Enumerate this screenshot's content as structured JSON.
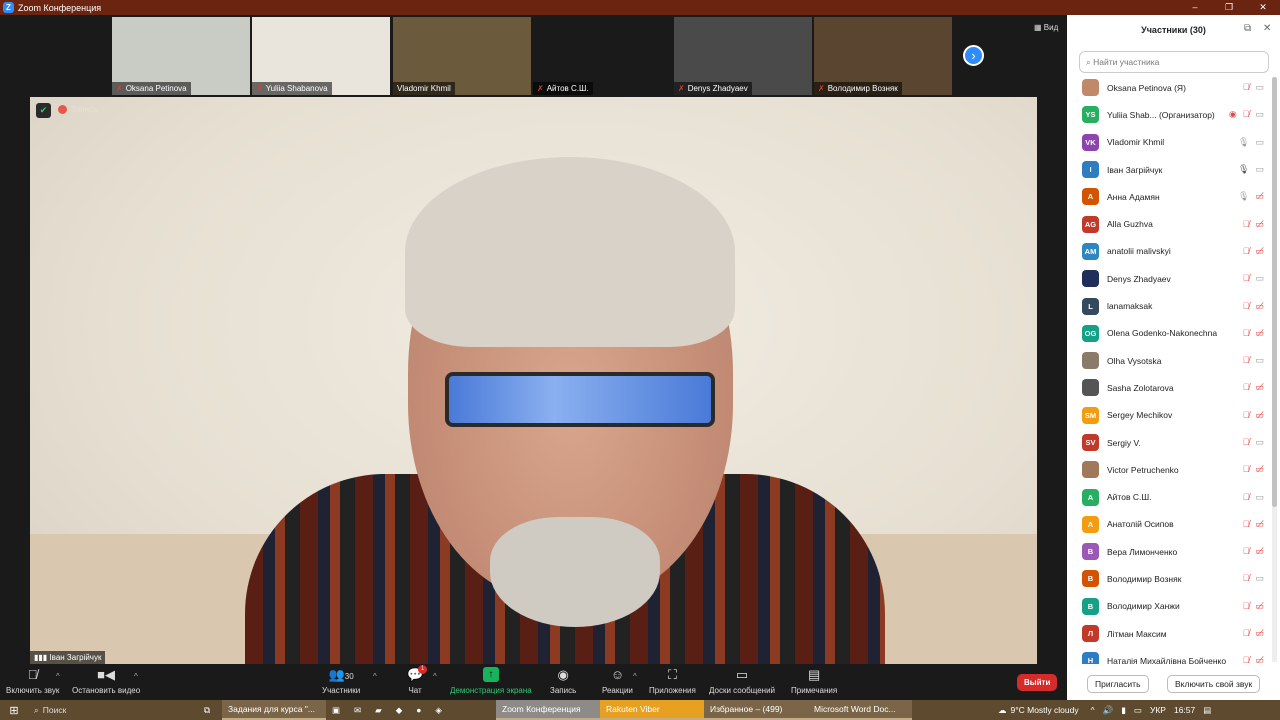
{
  "window": {
    "title": "Zoom Конференция",
    "controls": [
      "–",
      "❐",
      "✕"
    ]
  },
  "gallery": {
    "thumbnails": [
      {
        "name": "Oksana Petinova",
        "muted": true,
        "bg": "#c9ccc5"
      },
      {
        "name": "Yuliia Shabanova",
        "muted": true,
        "bg": "#e9e4dc"
      },
      {
        "name": "Vladomir Khmil",
        "muted": false,
        "bg": "#6b5a3c"
      },
      {
        "name": "Айтов  С.Ш.",
        "muted": true,
        "bg": "#1b1a1a"
      },
      {
        "name": "Denys Zhadyaev",
        "muted": true,
        "bg": "#4a4a4a"
      },
      {
        "name": "Володимир Возняк",
        "muted": true,
        "bg": "#5a4630"
      }
    ],
    "next_icon": "chevron-right-icon",
    "view_label": "Вид"
  },
  "main_video": {
    "speaker": "Іван Загрійчук",
    "recording_label": "Запись"
  },
  "toolbar": {
    "unmute": "Включить звук",
    "stop_video": "Остановить видео",
    "participants": "Участники",
    "participants_count": "30",
    "chat": "Чат",
    "chat_badge": "1",
    "share": "Демонстрация экрана",
    "record": "Запись",
    "reactions": "Реакции",
    "apps": "Приложения",
    "whiteboards": "Доски сообщений",
    "notes": "Примечания",
    "leave": "Выйти"
  },
  "panel": {
    "title": "Участники (30)",
    "search_placeholder": "Найти участника",
    "invite": "Пригласить",
    "unmute_self": "Включить свой звук",
    "participants": [
      {
        "name": "Oksana Petinova (Я)",
        "initials": "",
        "color": "#c08a6a",
        "mic": "muted",
        "video": "on"
      },
      {
        "name": "Yuliia Shab...  (Организатор)",
        "initials": "YS",
        "color": "#27ae60",
        "mic": "muted",
        "video": "on",
        "recording": true
      },
      {
        "name": "Vladomir Khmil",
        "initials": "VK",
        "color": "#8e44ad",
        "mic": "on",
        "video": "on"
      },
      {
        "name": "Іван Загрійчук",
        "initials": "I",
        "color": "#2e7dc1",
        "mic": "speaking",
        "video": "on"
      },
      {
        "name": "Анна Адамян",
        "initials": "A",
        "color": "#d35400",
        "mic": "on",
        "video": "off"
      },
      {
        "name": "Alla Guzhva",
        "initials": "AG",
        "color": "#c0392b",
        "mic": "muted",
        "video": "off"
      },
      {
        "name": "anatolii malivskyi",
        "initials": "AM",
        "color": "#2e86c1",
        "mic": "muted",
        "video": "off"
      },
      {
        "name": "Denys Zhadyaev",
        "initials": "",
        "color": "#1f2f5a",
        "mic": "muted",
        "video": "on"
      },
      {
        "name": "lanamaksak",
        "initials": "L",
        "color": "#34495e",
        "mic": "muted",
        "video": "off"
      },
      {
        "name": "Olena Godenko-Nakonechna",
        "initials": "OG",
        "color": "#16a085",
        "mic": "muted",
        "video": "off"
      },
      {
        "name": "Olha Vysotska",
        "initials": "",
        "color": "#8a7a6a",
        "mic": "muted",
        "video": "on"
      },
      {
        "name": "Sasha Zolotarova",
        "initials": "",
        "color": "#555",
        "mic": "muted",
        "video": "off"
      },
      {
        "name": "Sergey Mechikov",
        "initials": "SM",
        "color": "#f39c12",
        "mic": "muted",
        "video": "off"
      },
      {
        "name": "Sergiy V.",
        "initials": "SV",
        "color": "#c0392b",
        "mic": "muted",
        "video": "on"
      },
      {
        "name": "Victor Petruchenko",
        "initials": "",
        "color": "#a0785a",
        "mic": "muted",
        "video": "off"
      },
      {
        "name": "Айтов  С.Ш.",
        "initials": "A",
        "color": "#27ae60",
        "mic": "muted",
        "video": "on"
      },
      {
        "name": "Анатолій Осипов",
        "initials": "A",
        "color": "#f39c12",
        "mic": "muted",
        "video": "off"
      },
      {
        "name": "Вера Лимонченко",
        "initials": "B",
        "color": "#9b59b6",
        "mic": "muted",
        "video": "off"
      },
      {
        "name": "Володимир Возняк",
        "initials": "B",
        "color": "#d35400",
        "mic": "muted",
        "video": "on"
      },
      {
        "name": "Володимир Ханжи",
        "initials": "B",
        "color": "#16a085",
        "mic": "muted",
        "video": "off"
      },
      {
        "name": "Літман Максим",
        "initials": "Л",
        "color": "#c0392b",
        "mic": "muted",
        "video": "off"
      },
      {
        "name": "Наталія Михайлівна Бойченко",
        "initials": "Н",
        "color": "#2e7dc1",
        "mic": "muted",
        "video": "off"
      }
    ]
  },
  "taskbar": {
    "search": "Поиск",
    "apps": [
      "Задания для курса \"...",
      "Zoom Конференция",
      "Rakuten Viber",
      "Избранное – (499)",
      "Microsoft Word Doc..."
    ],
    "weather": "9°C  Mostly cloudy",
    "lang": "УКР",
    "time": "16:57"
  }
}
